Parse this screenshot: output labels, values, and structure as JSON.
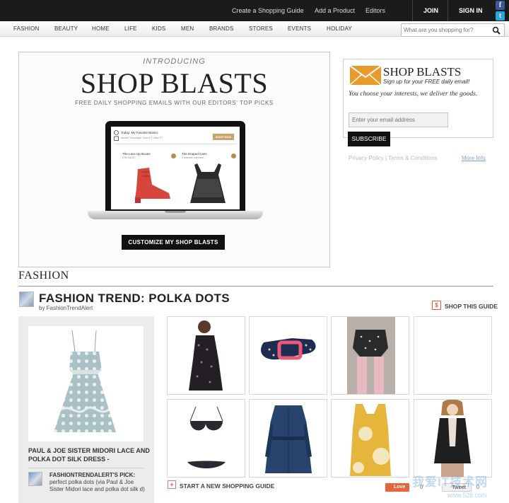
{
  "topbar": {
    "links": [
      "Create a Shopping Guide",
      "Add a Product",
      "Editors"
    ],
    "join": "JOIN",
    "signin": "SIGN IN",
    "facebook_glyph": "f",
    "twitter_glyph": "t"
  },
  "nav": {
    "items": [
      "FASHION",
      "BEAUTY",
      "HOME",
      "LIFE",
      "KIDS",
      "MEN",
      "BRANDS",
      "STORES",
      "EVENTS",
      "HOLIDAY"
    ],
    "search_placeholder": "What are you shopping for?"
  },
  "promo": {
    "introducing": "INTRODUCING",
    "title": "SHOP BLASTS",
    "tagline": "FREE DAILY SHOPPING EMAILS WITH OUR EDITORS' TOP PICKS",
    "screen": {
      "line1": "Today: My Favorite Basics",
      "line2": "Alerted Thursdays, 11am ET / 8am PT",
      "shop_now": "SHOP NOW",
      "item1": "The Lace Up Bootie",
      "item1_sub": "(ON SALE!)",
      "item2": "The Draped Cami",
      "item2_sub": "4 reasons, with love..."
    },
    "cta": "CUSTOMIZE MY SHOP BLASTS"
  },
  "signup": {
    "title": "SHOP BLASTS",
    "subtitle": "Sign up for your FREE daily email!",
    "description": "You choose your interests, we deliver the goods.",
    "email_placeholder": "Enter your email address",
    "subscribe": "SUBSCRIBE",
    "privacy": "Privacy Policy | Terms & Conditions",
    "more_info": "More Info"
  },
  "section": {
    "title": "FASHION"
  },
  "guide": {
    "title": "FASHION TREND: POLKA DOTS",
    "by": "by FashionTrendAlert",
    "shop_icon": "$",
    "shop_label": "SHOP THIS GUIDE",
    "start_icon": "+",
    "start_label": "START A NEW SHOPPING GUIDE"
  },
  "featured": {
    "title": "PAUL & JOE SISTER MIDORI LACE AND POLKA DOT SILK DRESS -",
    "pick_name": "FASHIONTRENDALERT'S PICK:",
    "pick_text": "perfect polka dots (via Paul & Joe Sister Midori lace and polka dot silk d)"
  },
  "social": {
    "love": "Love",
    "love_count": "0",
    "tweet": "Tweet",
    "tweet_count": "0"
  },
  "watermark": {
    "text": "我爱IT技术网",
    "url": "www.52it.com"
  },
  "colors": {
    "topbar": "#1b1b1b",
    "envelope": "#e89a2b",
    "love": "#e8643a",
    "accent_gold": "#c8a46a"
  }
}
